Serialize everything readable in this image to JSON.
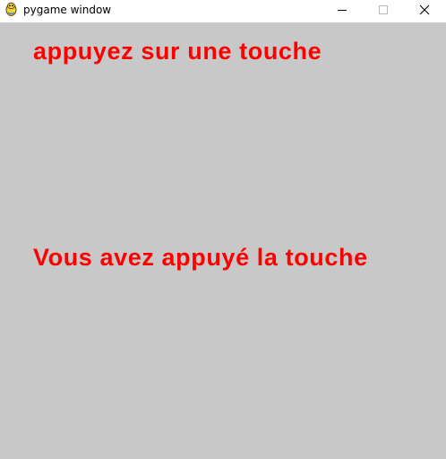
{
  "window": {
    "title": "pygame window",
    "background_color": "#c8c8c8",
    "icons": {
      "app": "pygame-snake-icon",
      "minimize": "minimize-icon",
      "maximize": "maximize-icon",
      "close": "close-icon"
    }
  },
  "content": {
    "text_color": "#ff0000",
    "line1": "appuyez sur une touche",
    "line2": "Vous avez appuyé la touche"
  }
}
